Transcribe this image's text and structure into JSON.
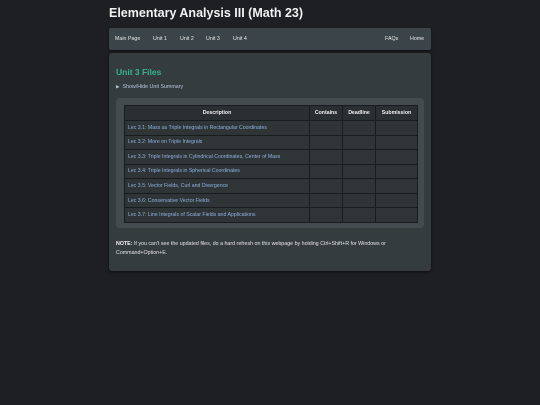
{
  "site": {
    "title": "Elementary Analysis III (Math 23)"
  },
  "nav": {
    "left": [
      {
        "label": "Main Page"
      },
      {
        "label": "Unit 1"
      },
      {
        "label": "Unit 2"
      },
      {
        "label": "Unit 3"
      },
      {
        "label": "Unit 4"
      }
    ],
    "right": [
      {
        "label": "FAQs"
      },
      {
        "label": "Home"
      }
    ]
  },
  "section": {
    "title": "Unit 3 Files",
    "toggle_label": "Show/Hide Unit Summary"
  },
  "table": {
    "headers": [
      "Description",
      "Contains",
      "Deadline",
      "Submission"
    ],
    "rows": [
      {
        "description": "Lec 3.1: Mass as Triple Integrals in Rectangular Coordinates"
      },
      {
        "description": "Lec 3.2: More on Triple Integrals"
      },
      {
        "description": "Lec 3.3: Triple Integrals in Cylindrical Coordinates, Center of Mass"
      },
      {
        "description": "Lec 3.4: Triple Integrals in Spherical Coordinates"
      },
      {
        "description": "Lec 3.5: Vector Fields, Curl and Divergence"
      },
      {
        "description": "Lec 3.6: Conservative Vector Fields"
      },
      {
        "description": "Lec 3.7: Line Integrals of Scalar Fields and Applications"
      }
    ]
  },
  "note": {
    "label": "NOTE:",
    "text": " If you can't see the updated files, do a hard refresh on this webpage by holding Ctrl+Shift+R for Windows or Command+Option+E."
  },
  "colors": {
    "page_bg": "#1e1f22",
    "accent_green": "#35b58f",
    "link_blue": "#8fb3e3"
  }
}
